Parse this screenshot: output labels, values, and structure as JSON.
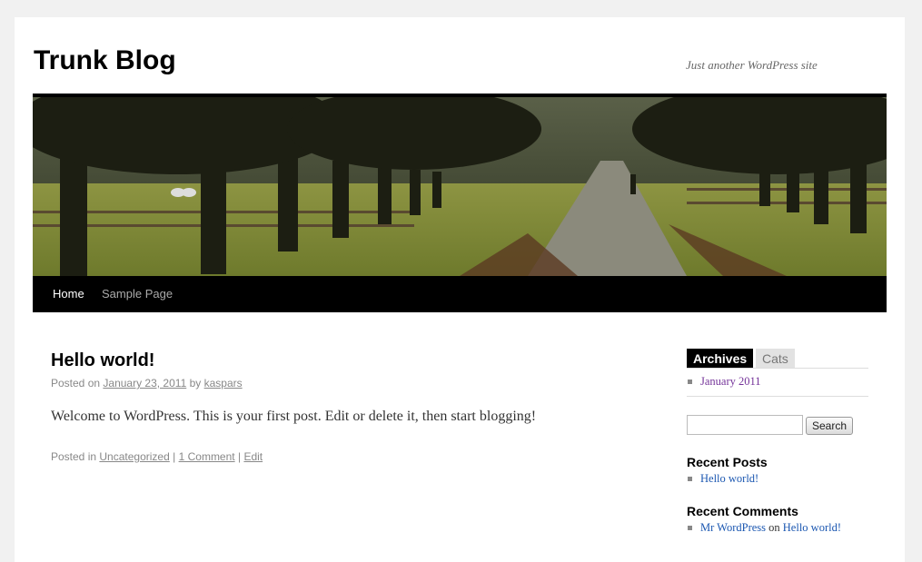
{
  "site": {
    "title": "Trunk Blog",
    "description": "Just another WordPress site"
  },
  "nav": {
    "items": [
      {
        "label": "Home",
        "current": true
      },
      {
        "label": "Sample Page",
        "current": false
      }
    ]
  },
  "post": {
    "title": "Hello world!",
    "meta_posted_on": "Posted on",
    "date": "January 23, 2011",
    "meta_by": "by",
    "author": "kaspars",
    "content": "Welcome to WordPress. This is your first post. Edit or delete it, then start blogging!",
    "footer_posted_in": "Posted in",
    "category": "Uncategorized",
    "separator": "|",
    "comments_link": "1 Comment",
    "edit_link": "Edit"
  },
  "sidebar": {
    "tabs": [
      {
        "label": "Archives",
        "active": true
      },
      {
        "label": "Cats",
        "active": false
      }
    ],
    "archives": [
      "January 2011"
    ],
    "search": {
      "value": "",
      "button_label": "Search"
    },
    "recent_posts": {
      "title": "Recent Posts",
      "items": [
        "Hello world!"
      ]
    },
    "recent_comments": {
      "title": "Recent Comments",
      "items": [
        {
          "author": "Mr WordPress",
          "connector": "on",
          "post": "Hello world!"
        }
      ]
    }
  },
  "colors": {
    "page_background": "#f1f1f1",
    "nav_background": "#000000",
    "link": "#1b57b1",
    "visited_link": "#743399"
  }
}
